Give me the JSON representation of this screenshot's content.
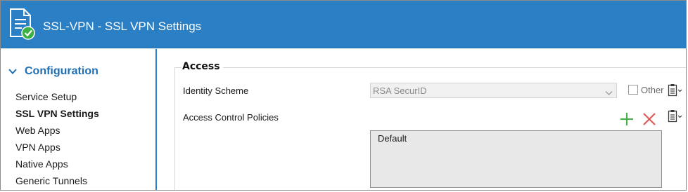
{
  "window": {
    "title": "SSL-VPN - SSL VPN Settings",
    "icon": "document-check-icon"
  },
  "sidebar": {
    "section_label": "Configuration",
    "items": [
      {
        "label": "Service Setup",
        "active": false
      },
      {
        "label": "SSL VPN Settings",
        "active": true
      },
      {
        "label": "Web Apps",
        "active": false
      },
      {
        "label": "VPN Apps",
        "active": false
      },
      {
        "label": "Native Apps",
        "active": false
      },
      {
        "label": "Generic Tunnels",
        "active": false
      }
    ]
  },
  "access": {
    "legend": "Access",
    "identity_scheme": {
      "label": "Identity Scheme",
      "value": "RSA SecurID",
      "disabled": true
    },
    "other": {
      "label": "Other",
      "checked": false
    },
    "policies": {
      "label": "Access Control Policies",
      "items": [
        "Default"
      ]
    }
  },
  "colors": {
    "titlebar": "#2b80c5",
    "accent": "#1f6fb5",
    "add": "#4caf50",
    "remove": "#e05a5a"
  }
}
